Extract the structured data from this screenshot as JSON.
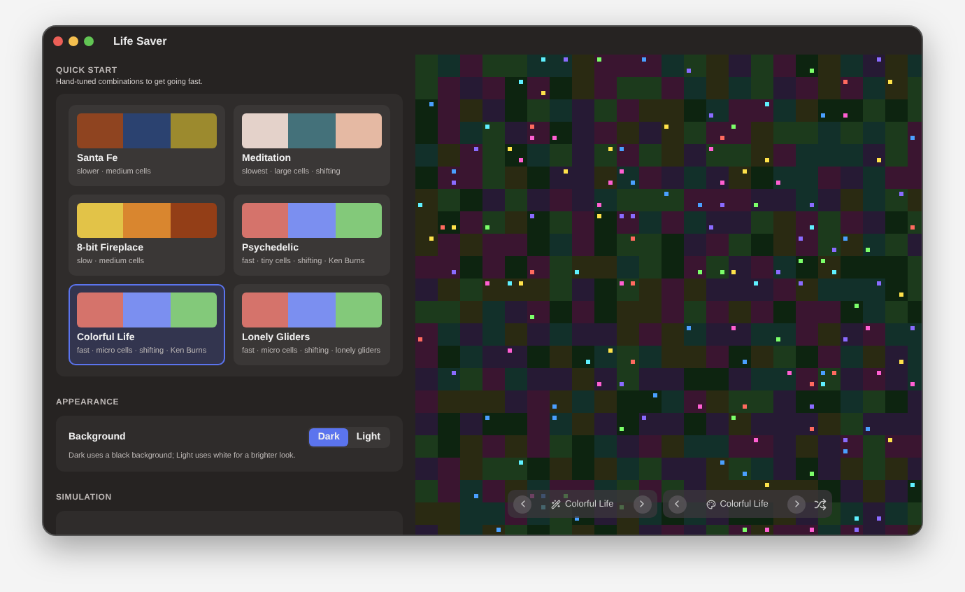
{
  "window": {
    "title": "Life Saver"
  },
  "quick_start": {
    "heading": "QUICK START",
    "subtitle": "Hand-tuned combinations to get going fast.",
    "presets": [
      {
        "name": "Santa Fe",
        "description": "slower · medium cells",
        "selected": false,
        "swatches": [
          {
            "color": "#8f4420"
          },
          {
            "color": "#2b4270"
          },
          {
            "color": "#9c8a2e"
          }
        ]
      },
      {
        "name": "Meditation",
        "description": "slowest · large cells · shifting",
        "selected": false,
        "swatches": [
          {
            "color": "#e4d2ca"
          },
          {
            "color": "#44717a"
          },
          {
            "color": "#e5b9a3"
          }
        ]
      },
      {
        "name": "8-bit Fireplace",
        "description": "slow · medium cells",
        "selected": false,
        "swatches": [
          {
            "color": "#e2c348"
          },
          {
            "color": "#d9862f"
          },
          {
            "color": "#933e17"
          }
        ]
      },
      {
        "name": "Psychedelic",
        "description": "fast · tiny cells · shifting · Ken Burns",
        "selected": false,
        "swatches": [
          {
            "color": "#d5736b"
          },
          {
            "color": "#7b8ff0"
          },
          {
            "color": "#83c97a"
          }
        ]
      },
      {
        "name": "Colorful Life",
        "description": "fast · micro cells · shifting · Ken Burns",
        "selected": true,
        "swatches": [
          {
            "color": "#d5736b"
          },
          {
            "color": "#7b8ff0"
          },
          {
            "color": "#83c97a"
          }
        ]
      },
      {
        "name": "Lonely Gliders",
        "description": "fast · micro cells · shifting · lonely gliders",
        "selected": false,
        "swatches": [
          {
            "color": "#d5736b"
          },
          {
            "color": "#7b8ff0"
          },
          {
            "color": "#83c97a"
          }
        ]
      }
    ]
  },
  "appearance": {
    "heading": "APPEARANCE",
    "title": "Background",
    "description": "Dark uses a black background; Light uses white for a brighter look.",
    "options": [
      {
        "label": "Dark",
        "selected": true
      },
      {
        "label": "Light",
        "selected": false
      }
    ]
  },
  "simulation": {
    "heading": "SIMULATION"
  },
  "preview_controls": [
    {
      "label": "Colorful Life"
    },
    {
      "label": "Colorful Life"
    }
  ]
}
